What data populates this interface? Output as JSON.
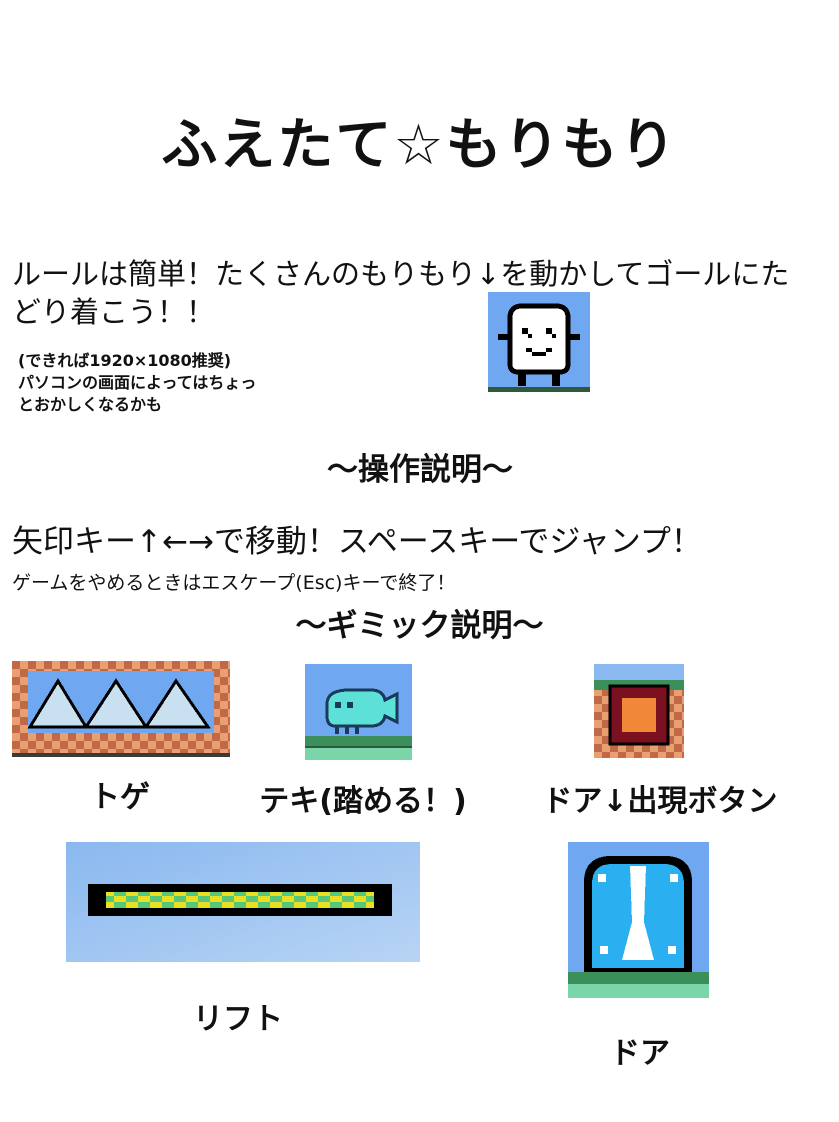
{
  "title": "ふえたて☆もりもり",
  "intro": {
    "rule_text": "ルールは簡単！たくさんのもりもり↓を動かしてゴールにたどり着こう！！",
    "note_line1": "(できれば1920×1080推奨)",
    "note_line2": "パソコンの画面によってはちょっとおかしくなるかも"
  },
  "controls_heading": "〜操作説明〜",
  "controls_text": "矢印キー↑←→で移動！スペースキーでジャンプ！",
  "exit_text": "ゲームをやめるときはエスケープ(Esc)キーで終了！",
  "gimmick_heading": "〜ギミック説明〜",
  "gimmicks": {
    "spike": "トゲ",
    "enemy": "テキ(踏める！)",
    "switch": "ドア↓出現ボタン",
    "lift": "リフト",
    "door": "ドア"
  },
  "colors": {
    "sky": "#6fa8f0",
    "brick_light": "#e8a070",
    "brick_dark": "#c06848",
    "grass": "#3a8f5a",
    "enemy": "#5ce0d8"
  }
}
